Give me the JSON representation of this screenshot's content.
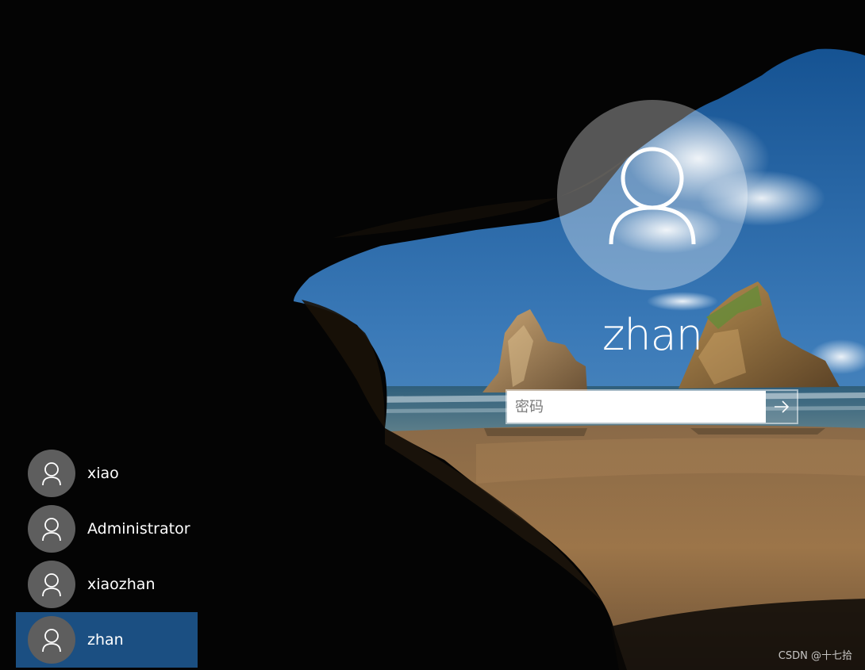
{
  "current_user": {
    "name": "zhan",
    "avatar_icon": "user-icon"
  },
  "password": {
    "placeholder": "密码",
    "value": "",
    "submit_icon": "arrow-right-icon"
  },
  "user_list": [
    {
      "name": "xiao",
      "selected": false
    },
    {
      "name": "Administrator",
      "selected": false
    },
    {
      "name": "xiaozhan",
      "selected": false
    },
    {
      "name": "zhan",
      "selected": true
    }
  ],
  "watermark": "CSDN @十七拾",
  "colors": {
    "selected_user_bg": "#1b4f82",
    "avatar_bg": "#5e5e5e"
  }
}
